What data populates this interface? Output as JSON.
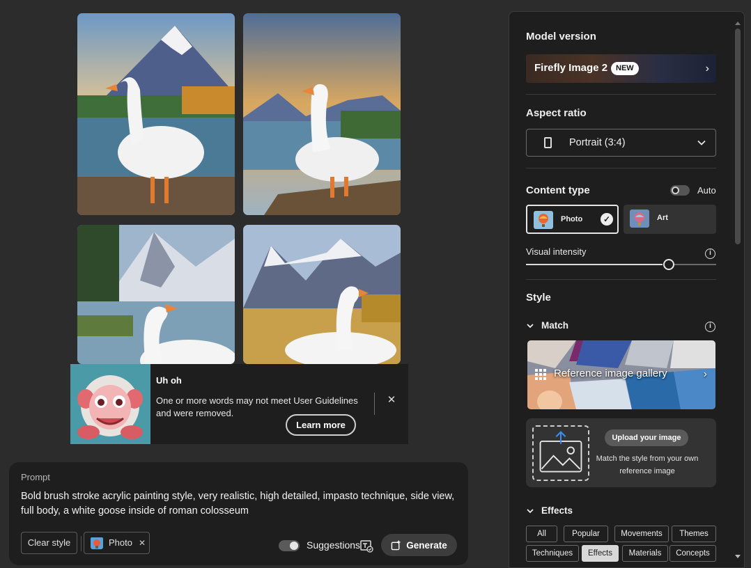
{
  "toast": {
    "title": "Uh oh",
    "message": "One or more words may not meet User Guidelines and were removed.",
    "learn_more": "Learn more",
    "close_glyph": "✕"
  },
  "prompt": {
    "label": "Prompt",
    "text": "Bold brush stroke acrylic painting style, very realistic, high detailed, impasto technique, side view, full body, a white goose inside of roman colosseum",
    "clear_style": "Clear style",
    "style_chip": "Photo",
    "style_chip_remove": "✕",
    "suggestions_label": "Suggestions",
    "suggestions_on": true,
    "generate_label": "Generate"
  },
  "panel": {
    "model": {
      "title": "Model version",
      "name": "Firefly Image 2",
      "badge": "NEW",
      "chevron": "›"
    },
    "aspect": {
      "title": "Aspect ratio",
      "value": "Portrait (3:4)"
    },
    "content_type": {
      "title": "Content type",
      "auto_label": "Auto",
      "auto_on": false,
      "options": [
        {
          "label": "Photo",
          "selected": true
        },
        {
          "label": "Art",
          "selected": false
        }
      ]
    },
    "intensity": {
      "label": "Visual intensity",
      "level_fraction": 0.73
    },
    "style": {
      "title": "Style",
      "match_label": "Match",
      "gallery_label": "Reference image gallery",
      "upload_button": "Upload your image",
      "upload_desc": "Match the style from your own reference image"
    },
    "effects": {
      "label": "Effects",
      "tabs": [
        "All",
        "Popular",
        "Movements",
        "Themes",
        "Techniques",
        "Effects",
        "Materials",
        "Concepts"
      ],
      "selected": "Effects"
    }
  },
  "colors": {
    "background": "#2c2c2c",
    "panel": "#1e1e1e",
    "accent_blue": "#3b8cf0"
  }
}
